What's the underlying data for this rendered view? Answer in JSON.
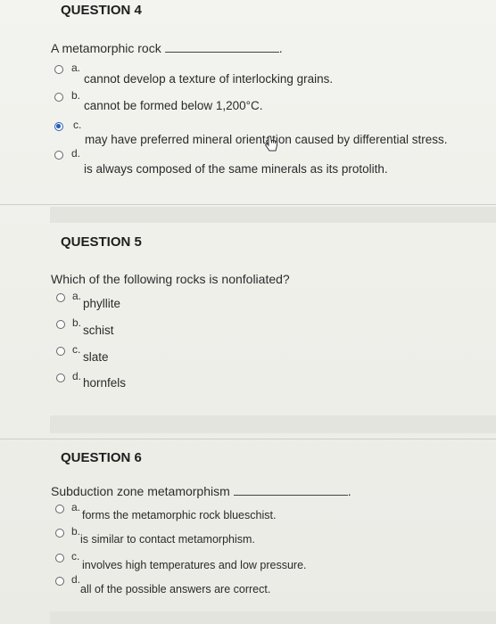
{
  "q4": {
    "heading": "QUESTION 4",
    "stem": "A metamorphic rock",
    "blank_suffix": ".",
    "options": [
      {
        "letter": "a.",
        "text": "cannot develop a texture of interlocking grains.",
        "selected": false
      },
      {
        "letter": "b.",
        "text": "cannot be formed below 1,200°C.",
        "selected": false
      },
      {
        "letter": "c.",
        "text": "may have preferred mineral orientation caused by differential stress.",
        "selected": true
      },
      {
        "letter": "d.",
        "text": "is always composed of the same minerals as its protolith.",
        "selected": false
      }
    ]
  },
  "q5": {
    "heading": "QUESTION 5",
    "stem": "Which of the following rocks is nonfoliated?",
    "options": [
      {
        "letter": "a.",
        "text": "phyllite",
        "selected": false
      },
      {
        "letter": "b.",
        "text": "schist",
        "selected": false
      },
      {
        "letter": "c.",
        "text": "slate",
        "selected": false
      },
      {
        "letter": "d.",
        "text": "hornfels",
        "selected": false
      }
    ]
  },
  "q6": {
    "heading": "QUESTION 6",
    "stem": "Subduction zone metamorphism",
    "blank_suffix": ".",
    "options": [
      {
        "letter": "a.",
        "text": "forms the metamorphic rock blueschist.",
        "selected": false
      },
      {
        "letter": "b.",
        "text": "is similar to contact metamorphism.",
        "selected": false
      },
      {
        "letter": "c.",
        "text": "involves high temperatures and low pressure.",
        "selected": false
      },
      {
        "letter": "d.",
        "text": "all of the possible answers are correct.",
        "selected": false
      }
    ]
  },
  "colors": {
    "selected_radio": "#2b5fb5"
  },
  "icons": {
    "cursor": "hand-pointer-icon"
  }
}
